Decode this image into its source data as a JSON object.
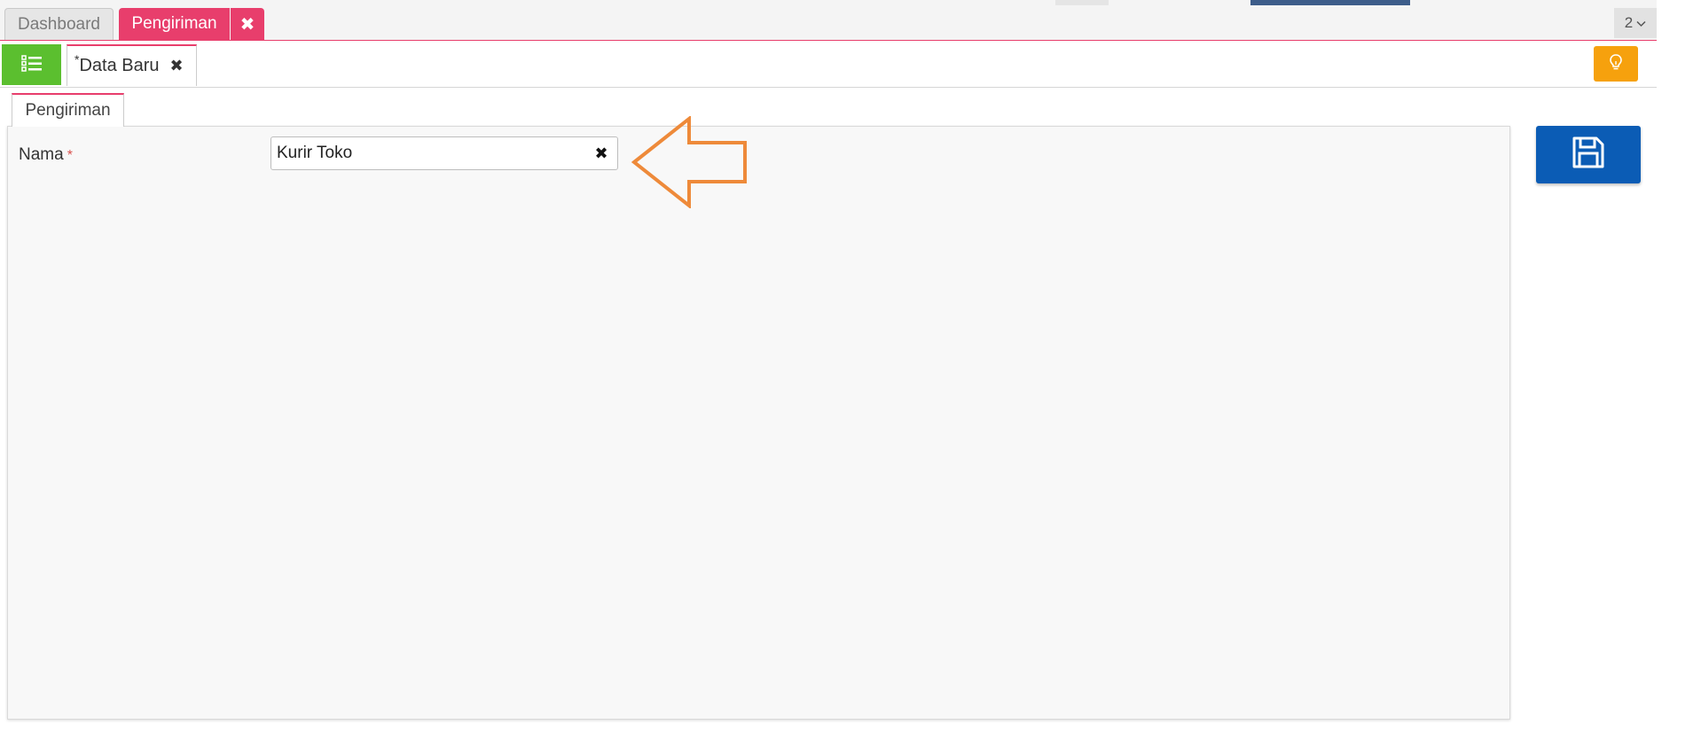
{
  "top_tabs": {
    "dashboard_label": "Dashboard",
    "active_label": "Pengiriman",
    "close_icon": "close-icon",
    "count": "2"
  },
  "doc_tab": {
    "star": "*",
    "label": "Data Baru"
  },
  "form": {
    "tab_label": "Pengiriman",
    "nama_label": "Nama",
    "required_mark": "*",
    "nama_value": "Kurir Toko"
  },
  "colors": {
    "accent_pink": "#e83e6c",
    "menu_green": "#5bbf2f",
    "tip_orange": "#f6a10d",
    "save_blue": "#0b5cb5",
    "arrow_orange": "#ee8a3a"
  },
  "icons": {
    "menu": "list-icon",
    "tip": "lightbulb-icon",
    "save": "floppy-disk-icon",
    "pointer": "arrow-left-annotation-icon"
  }
}
